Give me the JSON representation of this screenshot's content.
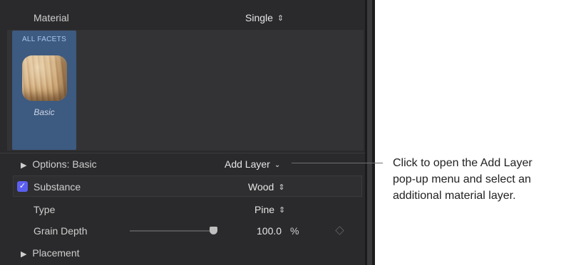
{
  "material_header": {
    "label": "Material",
    "value": "Single"
  },
  "facet_tile": {
    "title": "ALL FACETS",
    "name": "Basic"
  },
  "options": {
    "label": "Options: Basic",
    "add_layer_label": "Add Layer"
  },
  "substance": {
    "label": "Substance",
    "value": "Wood",
    "checked": true
  },
  "type": {
    "label": "Type",
    "value": "Pine"
  },
  "grain_depth": {
    "label": "Grain Depth",
    "value": "100.0",
    "unit": "%",
    "slider_fraction": 1.0
  },
  "placement": {
    "label": "Placement"
  },
  "callout": {
    "line1": "Click to open the Add Layer",
    "line2": "pop-up menu and select an",
    "line3": "additional material layer."
  },
  "colors": {
    "panel_bg": "#2a2a2c",
    "tile_selected": "#3d5a80",
    "checkbox_accent": "#5b5ff0"
  },
  "icons": {
    "disclosure": "disclosure-triangle-icon",
    "updown": "updown-arrows-icon",
    "chevron": "chevron-down-icon",
    "checkmark": "checkmark-icon",
    "keyframe": "keyframe-diamond-icon"
  }
}
